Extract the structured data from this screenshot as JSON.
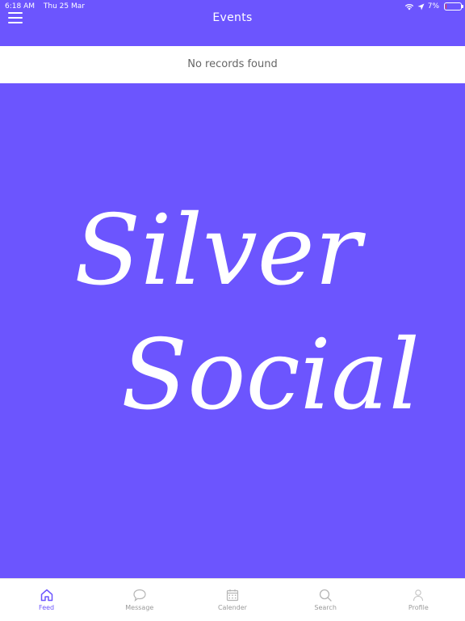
{
  "status_bar": {
    "time": "6:18 AM",
    "date": "Thu 25 Mar",
    "battery": "7%",
    "battery_level": 0.07,
    "icons": [
      "wifi-icon",
      "location-arrow-icon",
      "battery-icon"
    ]
  },
  "nav": {
    "title": "Events",
    "menu_icon": "hamburger-menu-icon"
  },
  "main": {
    "empty_message": "No records found",
    "logo_line_1": "Silver",
    "logo_line_2": "Social"
  },
  "tabs": [
    {
      "label": "Feed",
      "icon": "home-icon",
      "active": true
    },
    {
      "label": "Message",
      "icon": "chat-bubble-icon",
      "active": false
    },
    {
      "label": "Calender",
      "icon": "calendar-icon",
      "active": false
    },
    {
      "label": "Search",
      "icon": "search-icon",
      "active": false
    },
    {
      "label": "Profile",
      "icon": "profile-icon",
      "active": false
    }
  ],
  "colors": {
    "brand": "#6c55fe",
    "active_tab": "#6c55fe",
    "inactive_tab": "#9a9a9a"
  }
}
